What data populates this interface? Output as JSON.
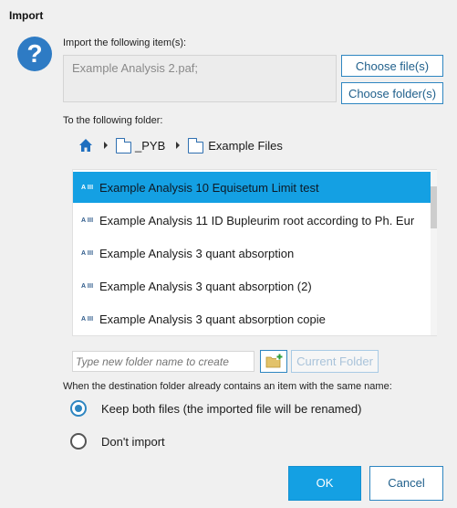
{
  "window": {
    "title": "Import"
  },
  "import_items": {
    "label": "Import the following item(s):",
    "value": "Example Analysis 2.paf;",
    "choose_files": "Choose file(s)",
    "choose_folders": "Choose folder(s)"
  },
  "destination": {
    "label": "To the following folder:",
    "breadcrumb": [
      "_PYB",
      "Example Files"
    ]
  },
  "folder_list": {
    "items": [
      {
        "label": "Example Analysis 10 Equisetum Limit test",
        "selected": true
      },
      {
        "label": "Example Analysis 11 ID Bupleurim root according to Ph. Eur",
        "selected": false
      },
      {
        "label": "Example Analysis 3 quant absorption",
        "selected": false
      },
      {
        "label": "Example Analysis 3 quant absorption (2)",
        "selected": false
      },
      {
        "label": "Example Analysis 3 quant absorption copie",
        "selected": false
      }
    ],
    "item_icon_text": "A III"
  },
  "new_folder": {
    "placeholder": "Type new folder name to create",
    "current_folder_label": "Current Folder"
  },
  "conflict": {
    "label": "When the destination folder already contains an item with the same name:",
    "options": [
      {
        "label": "Keep both files (the imported file will be renamed)",
        "selected": true
      },
      {
        "label": "Don't import",
        "selected": false
      }
    ]
  },
  "actions": {
    "ok": "OK",
    "cancel": "Cancel"
  },
  "colors": {
    "accent": "#14a0e3",
    "icon_blue": "#2e7bc4"
  }
}
